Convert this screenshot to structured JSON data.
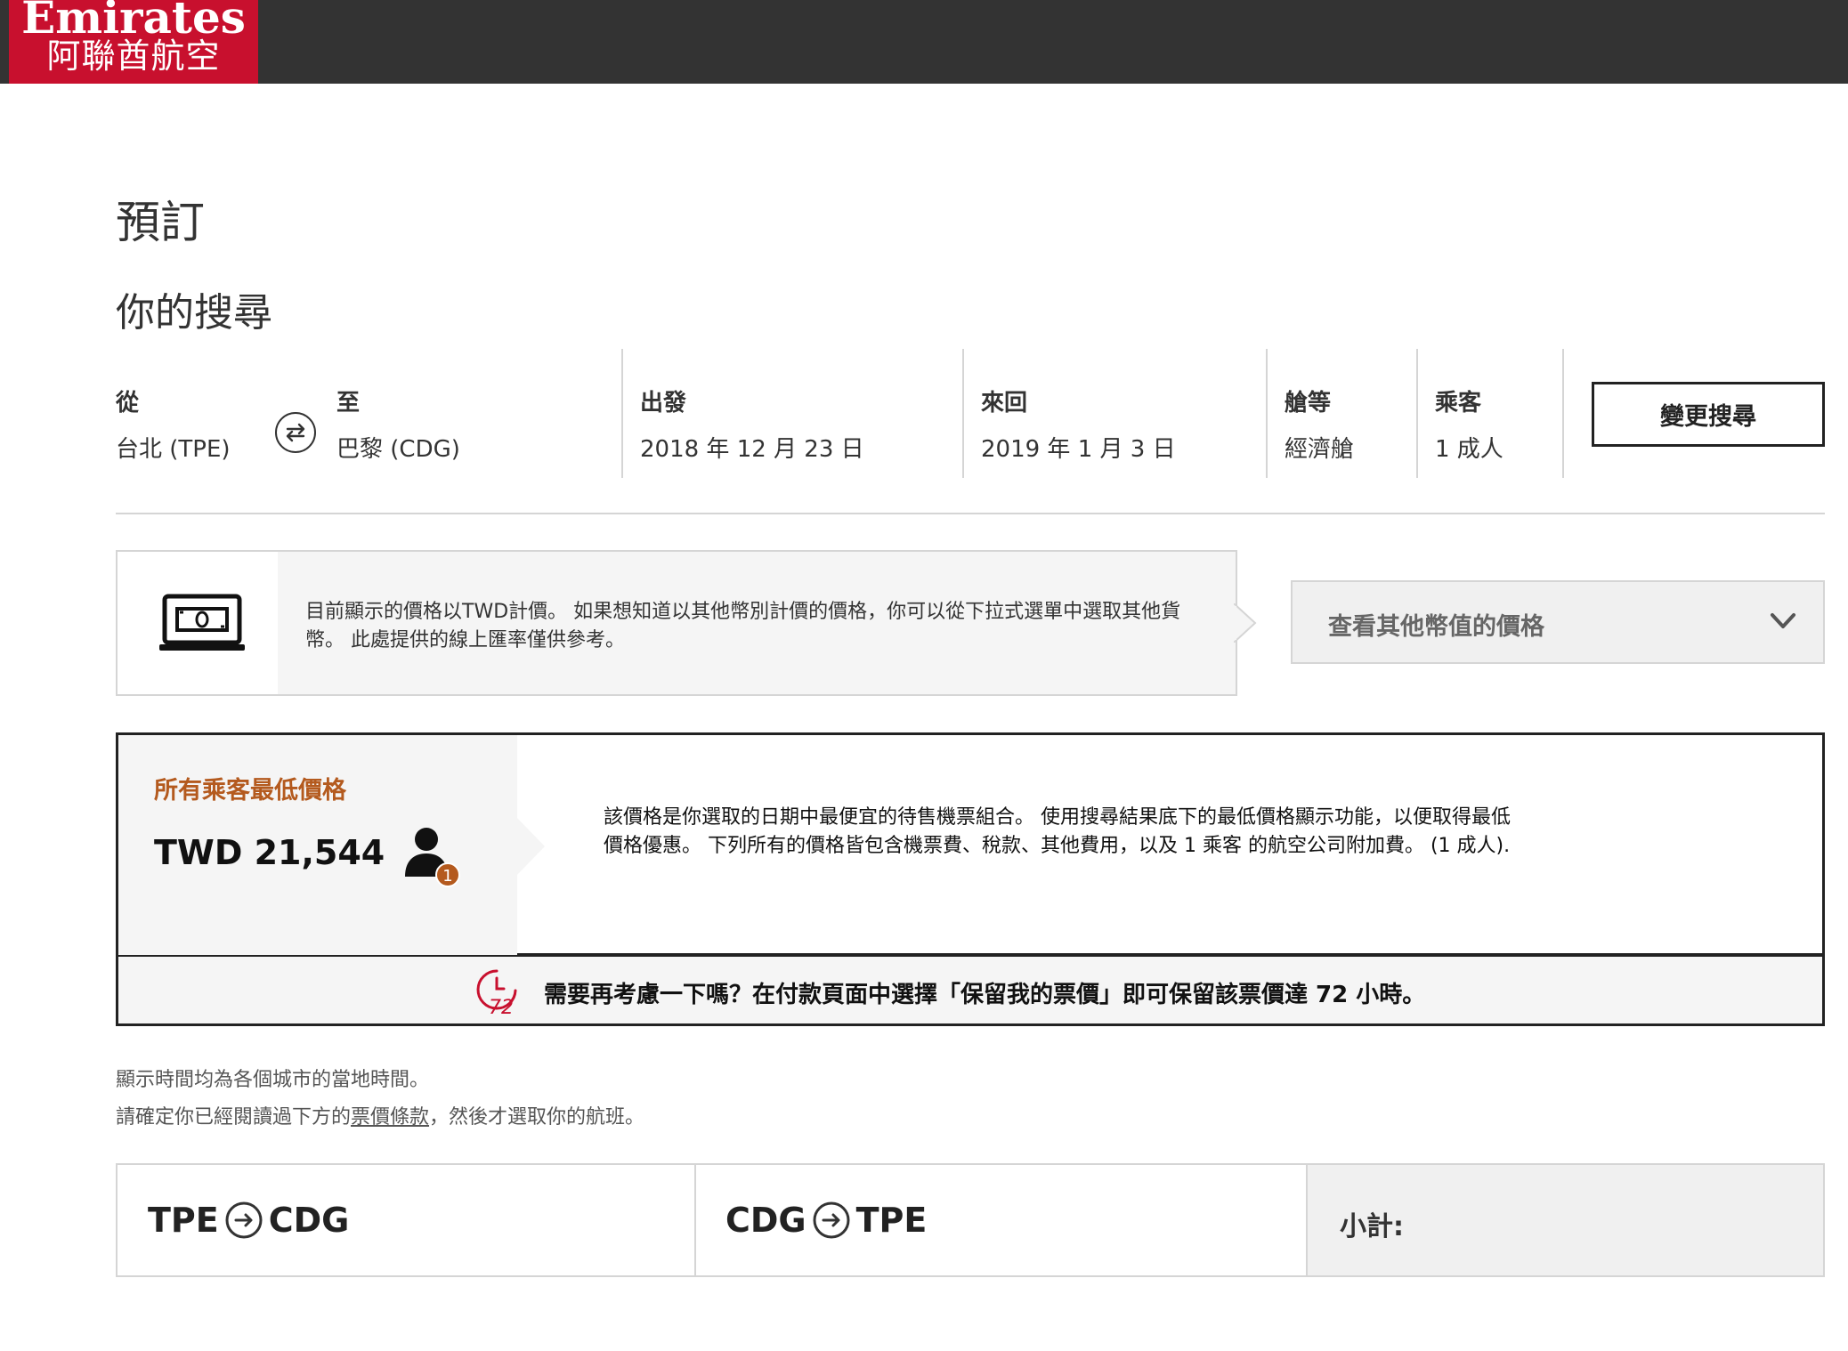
{
  "brand": {
    "name_en": "Emirates",
    "name_zh": "阿聯酋航空",
    "color": "#c8102e"
  },
  "page": {
    "title": "預訂",
    "subtitle": "你的搜尋"
  },
  "search": {
    "from_label": "從",
    "from_value": "台北 (TPE)",
    "to_label": "至",
    "to_value": "巴黎 (CDG)",
    "depart_label": "出發",
    "depart_value": "2018 年 12 月 23 日",
    "return_label": "來回",
    "return_value": "2019 年 1 月 3 日",
    "class_label": "艙等",
    "class_value": "經濟艙",
    "pax_label": "乘客",
    "pax_value": "1 成人",
    "change_button": "變更搜尋"
  },
  "currency": {
    "info_text": "目前顯示的價格以TWD計價。 如果想知道以其他幣別計價的價格，你可以從下拉式選單中選取其他貨幣。 此處提供的線上匯率僅供參考。",
    "select_label": "查看其他幣值的價格"
  },
  "lowest": {
    "title": "所有乘客最低價格",
    "price": "TWD 21,544",
    "pax_count": "1",
    "description": "該價格是你選取的日期中最便宜的待售機票組合。 使用搜尋結果底下的最低價格顯示功能，以便取得最低價格優惠。 下列所有的價格皆包含機票費、稅款、其他費用，以及 1 乘客 的航空公司附加費。 (1 成人).",
    "accent_color": "#b45a1e"
  },
  "hold": {
    "text": "需要再考慮一下嗎？在付款頁面中選擇「保留我的票價」即可保留該票價達 72 小時。",
    "clock_number": "72",
    "icon_color": "#c8102e"
  },
  "notes": {
    "line1": "顯示時間均為各個城市的當地時間。",
    "line2_pre": "請確定你已經閱讀過下方的",
    "line2_link": "票價條款",
    "line2_post": "，然後才選取你的航班。"
  },
  "legs": {
    "outbound_from": "TPE",
    "outbound_to": "CDG",
    "inbound_from": "CDG",
    "inbound_to": "TPE",
    "subtotal_label": "小計:"
  }
}
